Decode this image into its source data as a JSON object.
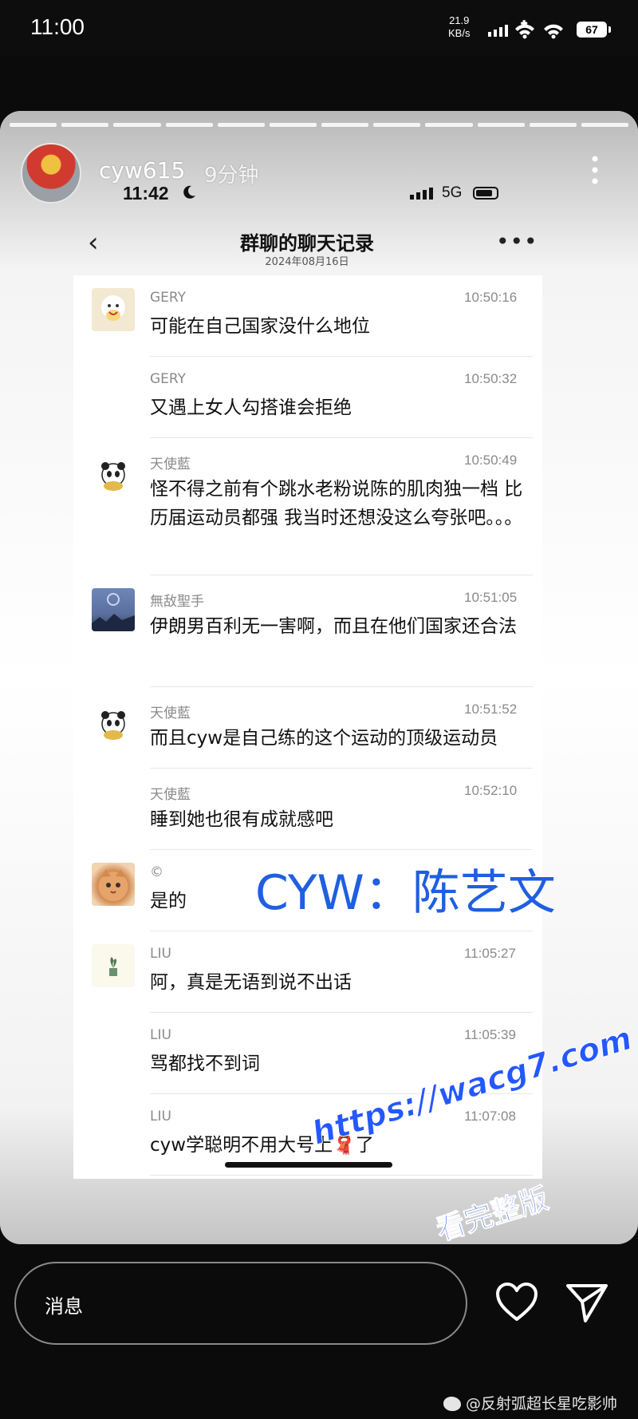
{
  "status_bar": {
    "time": "11:00",
    "speed": "21.9",
    "speed_unit": "KB/s",
    "battery": "67"
  },
  "story": {
    "username": "cyw615",
    "posted_ago": "9分钟",
    "inner_status": {
      "time": "11:42",
      "network": "5G"
    },
    "chat_header": {
      "title": "群聊的聊天记录",
      "date": "2024年08月16日"
    },
    "messages": [
      {
        "name": "GERY",
        "time": "10:50:16",
        "text": "可能在自己国家没什么地位",
        "avatar": "gery-avatar"
      },
      {
        "name": "GERY",
        "time": "10:50:32",
        "text": "又遇上女人勾搭谁会拒绝",
        "avatar": ""
      },
      {
        "name": "天使藍",
        "time": "10:50:49",
        "text": "怪不得之前有个跳水老粉说陈的肌肉独一档 比历届运动员都强 我当时还想没这么夸张吧。。。",
        "avatar": "panda-avatar"
      },
      {
        "name": "無敌聖手",
        "time": "10:51:05",
        "text": "伊朗男百利无一害啊，而且在他们国家还合法",
        "avatar": "sky-avatar"
      },
      {
        "name": "天使藍",
        "time": "10:51:52",
        "text": "而且cyw是自己练的这个运动的顶级运动员",
        "avatar": "panda-avatar"
      },
      {
        "name": "天使藍",
        "time": "10:52:10",
        "text": "睡到她也很有成就感吧",
        "avatar": ""
      },
      {
        "name": "©",
        "time": "",
        "text": "是的",
        "avatar": "cat-avatar"
      },
      {
        "name": "LIU",
        "time": "11:05:27",
        "text": "阿，真是无语到说不出话",
        "avatar": "plant-avatar"
      },
      {
        "name": "LIU",
        "time": "11:05:39",
        "text": "骂都找不到词",
        "avatar": ""
      },
      {
        "name": "LIU",
        "time": "11:07:08",
        "text": "cyw学聪明不用大号上🧣了",
        "avatar": ""
      }
    ],
    "overlay_text": "CYW：陈艺文",
    "watermark_url": "https://wacg7.com",
    "watermark_sub": "看完整版"
  },
  "reply_bar": {
    "placeholder": "消息"
  },
  "footer": {
    "credit": "@反射弧超长星吃影帅"
  },
  "colors": {
    "overlay_blue": "#1f5fe0",
    "watermark_blue": "#2458ff",
    "background": "#0b0b0b"
  }
}
